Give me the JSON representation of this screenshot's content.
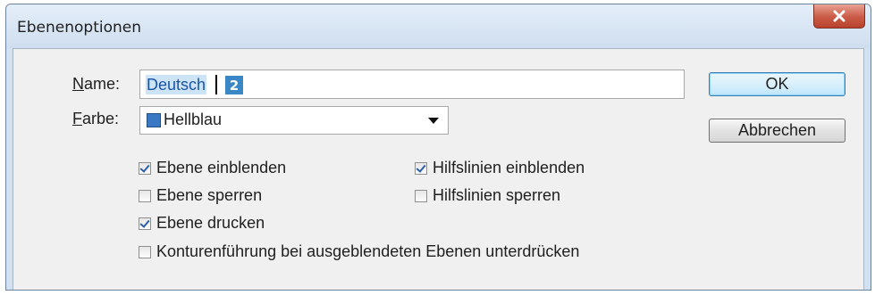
{
  "window": {
    "title": "Ebenenoptionen",
    "close_glyph": "x"
  },
  "form": {
    "name_label": "Name:",
    "name_value": "Deutsch",
    "badge": "2",
    "color_label": "Farbe:",
    "color_value": "Hellblau",
    "color_swatch": "#3a78c4"
  },
  "buttons": {
    "ok": "OK",
    "cancel": "Abbrechen"
  },
  "checkboxes": {
    "show_layer": {
      "label": "Ebene einblenden",
      "checked": true
    },
    "show_guides": {
      "label": "Hilfslinien einblenden",
      "checked": true
    },
    "lock_layer": {
      "label": "Ebene sperren",
      "checked": false
    },
    "lock_guides": {
      "label": "Hilfslinien sperren",
      "checked": false
    },
    "print_layer": {
      "label": "Ebene drucken",
      "checked": true
    },
    "suppress_wrap": {
      "label": "Konturenführung bei ausgeblendeten Ebenen unterdrücken",
      "checked": false
    }
  }
}
